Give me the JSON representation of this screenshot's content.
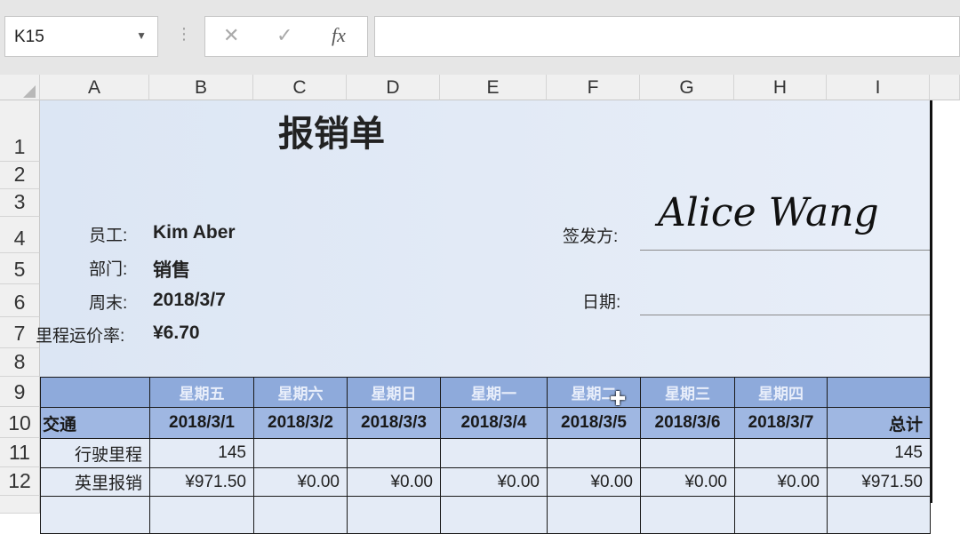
{
  "formula_bar": {
    "name_box": "K15",
    "cancel_icon": "✕",
    "enter_icon": "✓",
    "fx_label": "fx",
    "formula": ""
  },
  "columns": [
    "A",
    "B",
    "C",
    "D",
    "E",
    "F",
    "G",
    "H",
    "I"
  ],
  "rows": [
    "1",
    "2",
    "3",
    "4",
    "5",
    "6",
    "7",
    "8",
    "9",
    "10",
    "11",
    "12"
  ],
  "sheet": {
    "title": "报销单",
    "employee_label": "员工:",
    "employee": "Kim Aber",
    "dept_label": "部门:",
    "dept": "销售",
    "week_end_label": "周末:",
    "week_end": "2018/3/7",
    "rate_label": "里程运价率:",
    "rate": "¥6.70",
    "issuer_label": "签发方:",
    "signature": "Alice Wang",
    "date_label": "日期:",
    "weekdays": [
      "星期五",
      "星期六",
      "星期日",
      "星期一",
      "星期二",
      "星期三",
      "星期四"
    ],
    "section": "交通",
    "dates": [
      "2018/3/1",
      "2018/3/2",
      "2018/3/3",
      "2018/3/4",
      "2018/3/5",
      "2018/3/6",
      "2018/3/7"
    ],
    "total_label": "总计",
    "rows": [
      {
        "label": "行驶里程",
        "values": [
          "145",
          "",
          "",
          "",
          "",
          "",
          ""
        ],
        "total": "145"
      },
      {
        "label": "英里报销",
        "values": [
          "¥971.50",
          "¥0.00",
          "¥0.00",
          "¥0.00",
          "¥0.00",
          "¥0.00",
          "¥0.00"
        ],
        "total": "¥971.50"
      }
    ]
  }
}
